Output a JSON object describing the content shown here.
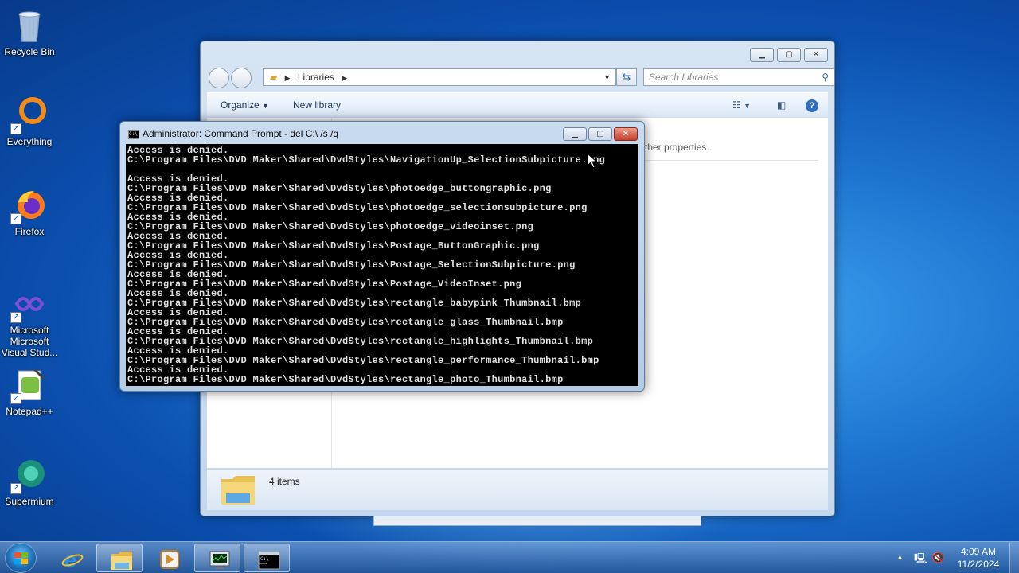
{
  "desktop": {
    "icons": [
      {
        "label": "Recycle Bin",
        "icon": "recycle-bin-icon"
      },
      {
        "label": "Everything",
        "icon": "everything-search-icon"
      },
      {
        "label": "Firefox",
        "icon": "firefox-icon"
      },
      {
        "label": "Microsoft Visual Stud...",
        "icon": "visual-studio-icon"
      },
      {
        "label": "Notepad++",
        "icon": "notepad-plus-plus-icon"
      },
      {
        "label": "Supermium",
        "icon": "supermium-browser-icon"
      }
    ]
  },
  "explorer": {
    "breadcrumb": "Libraries",
    "search_placeholder": "Search Libraries",
    "toolbar": {
      "organize": "Organize",
      "new_library": "New library"
    },
    "props_text": "ther properties.",
    "item_count": "4 items"
  },
  "cmd": {
    "title": "Administrator:  Command Prompt - del  C:\\ /s /q",
    "lines": [
      "Access is denied.",
      "C:\\Program Files\\DVD Maker\\Shared\\DvdStyles\\NavigationUp_SelectionSubpicture.png",
      "",
      "Access is denied.",
      "C:\\Program Files\\DVD Maker\\Shared\\DvdStyles\\photoedge_buttongraphic.png",
      "Access is denied.",
      "C:\\Program Files\\DVD Maker\\Shared\\DvdStyles\\photoedge_selectionsubpicture.png",
      "Access is denied.",
      "C:\\Program Files\\DVD Maker\\Shared\\DvdStyles\\photoedge_videoinset.png",
      "Access is denied.",
      "C:\\Program Files\\DVD Maker\\Shared\\DvdStyles\\Postage_ButtonGraphic.png",
      "Access is denied.",
      "C:\\Program Files\\DVD Maker\\Shared\\DvdStyles\\Postage_SelectionSubpicture.png",
      "Access is denied.",
      "C:\\Program Files\\DVD Maker\\Shared\\DvdStyles\\Postage_VideoInset.png",
      "Access is denied.",
      "C:\\Program Files\\DVD Maker\\Shared\\DvdStyles\\rectangle_babypink_Thumbnail.bmp",
      "Access is denied.",
      "C:\\Program Files\\DVD Maker\\Shared\\DvdStyles\\rectangle_glass_Thumbnail.bmp",
      "Access is denied.",
      "C:\\Program Files\\DVD Maker\\Shared\\DvdStyles\\rectangle_highlights_Thumbnail.bmp",
      "Access is denied.",
      "C:\\Program Files\\DVD Maker\\Shared\\DvdStyles\\rectangle_performance_Thumbnail.bmp",
      "Access is denied.",
      "C:\\Program Files\\DVD Maker\\Shared\\DvdStyles\\rectangle_photo_Thumbnail.bmp"
    ],
    "icon_text": "C:\\"
  },
  "taskbar": {
    "apps": [
      {
        "name": "internet-explorer",
        "icon": "internet-explorer-icon",
        "active": false
      },
      {
        "name": "windows-explorer",
        "icon": "folder-icon",
        "active": true
      },
      {
        "name": "media-player",
        "icon": "media-player-icon",
        "active": false
      },
      {
        "name": "task-manager",
        "icon": "task-manager-icon",
        "active": true
      },
      {
        "name": "command-prompt",
        "icon": "command-prompt-icon",
        "active": true
      }
    ],
    "time": "4:09 AM",
    "date": "11/2/2024"
  }
}
